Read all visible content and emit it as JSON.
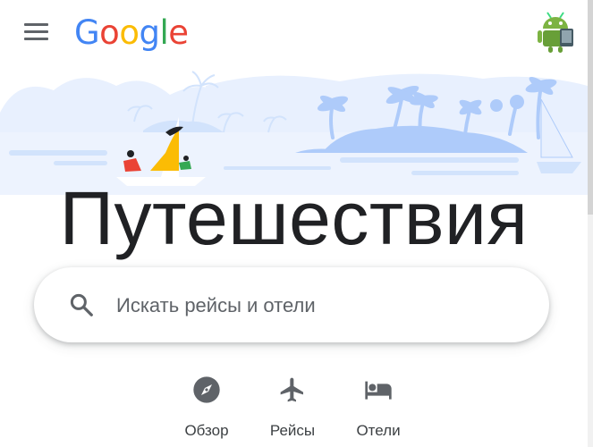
{
  "header": {
    "logo": {
      "letters": [
        {
          "char": "G",
          "color": "#4285F4"
        },
        {
          "char": "o",
          "color": "#EA4335"
        },
        {
          "char": "o",
          "color": "#FBBC05"
        },
        {
          "char": "g",
          "color": "#4285F4"
        },
        {
          "char": "l",
          "color": "#34A853"
        },
        {
          "char": "e",
          "color": "#EA4335"
        }
      ]
    },
    "menu_icon": "hamburger-menu-icon",
    "avatar_icon": "android-avatar-icon"
  },
  "hero": {
    "illustration": "travel-illustration",
    "title": "Путешествия"
  },
  "search": {
    "placeholder": "Искать рейсы и отели",
    "value": "",
    "icon": "search-icon"
  },
  "nav": {
    "items": [
      {
        "label": "Обзор",
        "icon": "compass-icon"
      },
      {
        "label": "Рейсы",
        "icon": "flight-icon"
      },
      {
        "label": "Отели",
        "icon": "hotel-bed-icon"
      }
    ]
  },
  "colors": {
    "icon_gray": "#5f6368",
    "text": "#202124",
    "illustration_light_blue": "#d2e3fc",
    "illustration_blue": "#aecbfa",
    "sail_yellow": "#fbbc04"
  }
}
